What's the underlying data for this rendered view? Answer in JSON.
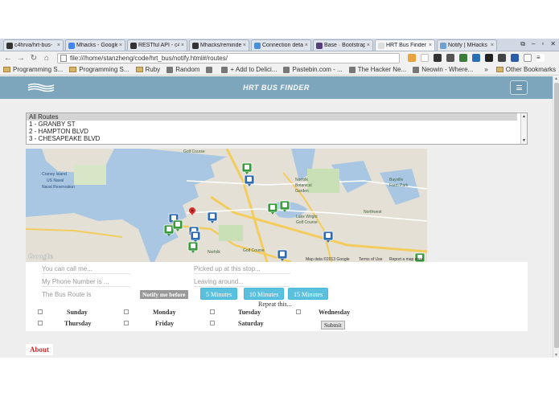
{
  "browser": {
    "tabs": [
      {
        "label": "c4hrva/hrt-bus-",
        "icon_color": "#333333",
        "active": false
      },
      {
        "label": "Mhacks - Google",
        "icon_color": "#4285f4",
        "active": false
      },
      {
        "label": "RESTful API - c4",
        "icon_color": "#333333",
        "active": false
      },
      {
        "label": "Mhacks/reminde",
        "icon_color": "#333333",
        "active": false
      },
      {
        "label": "Connection deta",
        "icon_color": "#4a90d9",
        "active": false
      },
      {
        "label": "Base · Bootstrap",
        "icon_color": "#563d7c",
        "active": false
      },
      {
        "label": "HRT Bus Finder",
        "icon_color": "#dddddd",
        "active": true
      },
      {
        "label": "Notify | MHacks",
        "icon_color": "#6fa0d0",
        "active": false
      }
    ],
    "tab_close_glyph": "×",
    "window_controls": [
      "⧉",
      "–",
      "▫",
      "✕"
    ],
    "nav": {
      "back": "←",
      "forward": "→",
      "reload": "↻",
      "home": "⌂"
    },
    "url": "file:///home/stanzheng/code/hrt_bus/notify.html#/routes/",
    "bookmarks": [
      {
        "label": "Programming S...",
        "type": "folder"
      },
      {
        "label": "Programming S...",
        "type": "folder"
      },
      {
        "label": "Ruby",
        "type": "folder"
      },
      {
        "label": "Random",
        "type": "link"
      },
      {
        "label": "",
        "type": "link"
      },
      {
        "label": "+ Add to Delici...",
        "type": "link"
      },
      {
        "label": "Pastebin.com - ...",
        "type": "link"
      },
      {
        "label": "The Hacker Ne...",
        "type": "link"
      },
      {
        "label": "Neowin - Where...",
        "type": "link"
      }
    ],
    "other_bookmarks": "Other Bookmarks",
    "bookmarks_overflow": "»"
  },
  "app": {
    "brand": "HRT BUS FINDER",
    "routes": [
      "All Routes",
      "1 - GRANBY ST",
      "2 - HAMPTON BLVD",
      "3 - CHESAPEAKE BLVD"
    ],
    "map": {
      "place_labels": [
        {
          "text": "Craney Island",
          "cls": "water"
        },
        {
          "text": "US Naval",
          "cls": "water"
        },
        {
          "text": "Naval Reservation",
          "cls": "water"
        },
        {
          "text": "Golf Course",
          "cls": "land"
        },
        {
          "text": "Norfolk",
          "cls": "land"
        },
        {
          "text": "Botanical",
          "cls": "land"
        },
        {
          "text": "Garden",
          "cls": "land"
        },
        {
          "text": "Bayville",
          "cls": "land"
        },
        {
          "text": "Farm Park",
          "cls": "land"
        },
        {
          "text": "Lake Wright",
          "cls": "land"
        },
        {
          "text": "Golf Course",
          "cls": "land"
        },
        {
          "text": "Northwest",
          "cls": "land"
        },
        {
          "text": "Golf Course",
          "cls": "land"
        },
        {
          "text": "Norfolk",
          "cls": "land"
        }
      ],
      "google_logo": "Google",
      "attribution": "Map data ©2013 Google",
      "terms": "Terms of Use",
      "report": "Report a map error"
    },
    "form": {
      "name_placeholder": "You can call me...",
      "pickup_placeholder": "Picked up at this stop...",
      "phone_placeholder": "My Phone Number is ...",
      "leaving_placeholder": "Leaving around...",
      "route_placeholder": "The Bus Route is",
      "notify_label": "Notify me before",
      "minute_buttons": [
        "5 Minutes",
        "10 Minutes",
        "15 Minutes"
      ],
      "repeat_label": "Repeat this...",
      "days": [
        "Sunday",
        "Monday",
        "Tuesday",
        "Wednesday",
        "Thursday",
        "Friday",
        "Saturday"
      ],
      "submit": "Submit"
    },
    "about": "About"
  },
  "colors": {
    "navbar": "#7da6bd",
    "info_button": "#5bc0de",
    "marker_green": "#3a9b3e",
    "marker_blue": "#2e6bb0",
    "pin_red": "#d9332c",
    "about_red": "#c9302c"
  }
}
